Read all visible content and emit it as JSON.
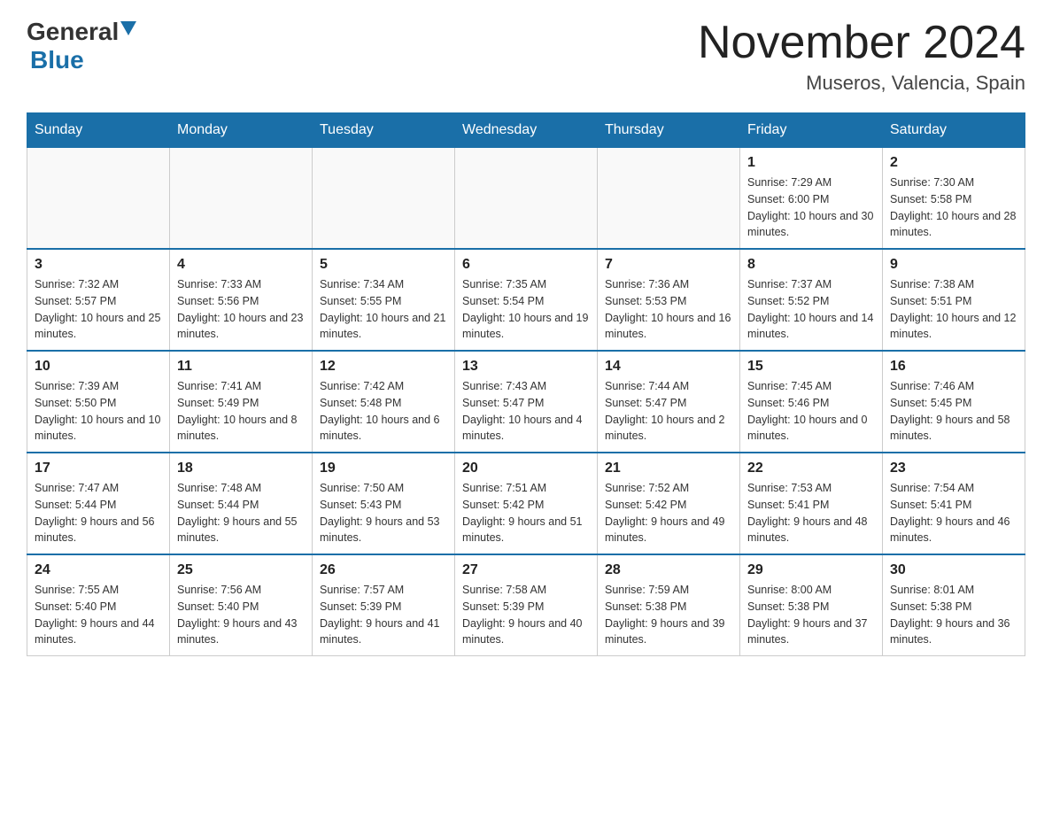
{
  "header": {
    "logo_general": "General",
    "logo_blue": "Blue",
    "month_title": "November 2024",
    "location": "Museros, Valencia, Spain"
  },
  "weekdays": [
    "Sunday",
    "Monday",
    "Tuesday",
    "Wednesday",
    "Thursday",
    "Friday",
    "Saturday"
  ],
  "weeks": [
    [
      {
        "day": "",
        "sunrise": "",
        "sunset": "",
        "daylight": ""
      },
      {
        "day": "",
        "sunrise": "",
        "sunset": "",
        "daylight": ""
      },
      {
        "day": "",
        "sunrise": "",
        "sunset": "",
        "daylight": ""
      },
      {
        "day": "",
        "sunrise": "",
        "sunset": "",
        "daylight": ""
      },
      {
        "day": "",
        "sunrise": "",
        "sunset": "",
        "daylight": ""
      },
      {
        "day": "1",
        "sunrise": "Sunrise: 7:29 AM",
        "sunset": "Sunset: 6:00 PM",
        "daylight": "Daylight: 10 hours and 30 minutes."
      },
      {
        "day": "2",
        "sunrise": "Sunrise: 7:30 AM",
        "sunset": "Sunset: 5:58 PM",
        "daylight": "Daylight: 10 hours and 28 minutes."
      }
    ],
    [
      {
        "day": "3",
        "sunrise": "Sunrise: 7:32 AM",
        "sunset": "Sunset: 5:57 PM",
        "daylight": "Daylight: 10 hours and 25 minutes."
      },
      {
        "day": "4",
        "sunrise": "Sunrise: 7:33 AM",
        "sunset": "Sunset: 5:56 PM",
        "daylight": "Daylight: 10 hours and 23 minutes."
      },
      {
        "day": "5",
        "sunrise": "Sunrise: 7:34 AM",
        "sunset": "Sunset: 5:55 PM",
        "daylight": "Daylight: 10 hours and 21 minutes."
      },
      {
        "day": "6",
        "sunrise": "Sunrise: 7:35 AM",
        "sunset": "Sunset: 5:54 PM",
        "daylight": "Daylight: 10 hours and 19 minutes."
      },
      {
        "day": "7",
        "sunrise": "Sunrise: 7:36 AM",
        "sunset": "Sunset: 5:53 PM",
        "daylight": "Daylight: 10 hours and 16 minutes."
      },
      {
        "day": "8",
        "sunrise": "Sunrise: 7:37 AM",
        "sunset": "Sunset: 5:52 PM",
        "daylight": "Daylight: 10 hours and 14 minutes."
      },
      {
        "day": "9",
        "sunrise": "Sunrise: 7:38 AM",
        "sunset": "Sunset: 5:51 PM",
        "daylight": "Daylight: 10 hours and 12 minutes."
      }
    ],
    [
      {
        "day": "10",
        "sunrise": "Sunrise: 7:39 AM",
        "sunset": "Sunset: 5:50 PM",
        "daylight": "Daylight: 10 hours and 10 minutes."
      },
      {
        "day": "11",
        "sunrise": "Sunrise: 7:41 AM",
        "sunset": "Sunset: 5:49 PM",
        "daylight": "Daylight: 10 hours and 8 minutes."
      },
      {
        "day": "12",
        "sunrise": "Sunrise: 7:42 AM",
        "sunset": "Sunset: 5:48 PM",
        "daylight": "Daylight: 10 hours and 6 minutes."
      },
      {
        "day": "13",
        "sunrise": "Sunrise: 7:43 AM",
        "sunset": "Sunset: 5:47 PM",
        "daylight": "Daylight: 10 hours and 4 minutes."
      },
      {
        "day": "14",
        "sunrise": "Sunrise: 7:44 AM",
        "sunset": "Sunset: 5:47 PM",
        "daylight": "Daylight: 10 hours and 2 minutes."
      },
      {
        "day": "15",
        "sunrise": "Sunrise: 7:45 AM",
        "sunset": "Sunset: 5:46 PM",
        "daylight": "Daylight: 10 hours and 0 minutes."
      },
      {
        "day": "16",
        "sunrise": "Sunrise: 7:46 AM",
        "sunset": "Sunset: 5:45 PM",
        "daylight": "Daylight: 9 hours and 58 minutes."
      }
    ],
    [
      {
        "day": "17",
        "sunrise": "Sunrise: 7:47 AM",
        "sunset": "Sunset: 5:44 PM",
        "daylight": "Daylight: 9 hours and 56 minutes."
      },
      {
        "day": "18",
        "sunrise": "Sunrise: 7:48 AM",
        "sunset": "Sunset: 5:44 PM",
        "daylight": "Daylight: 9 hours and 55 minutes."
      },
      {
        "day": "19",
        "sunrise": "Sunrise: 7:50 AM",
        "sunset": "Sunset: 5:43 PM",
        "daylight": "Daylight: 9 hours and 53 minutes."
      },
      {
        "day": "20",
        "sunrise": "Sunrise: 7:51 AM",
        "sunset": "Sunset: 5:42 PM",
        "daylight": "Daylight: 9 hours and 51 minutes."
      },
      {
        "day": "21",
        "sunrise": "Sunrise: 7:52 AM",
        "sunset": "Sunset: 5:42 PM",
        "daylight": "Daylight: 9 hours and 49 minutes."
      },
      {
        "day": "22",
        "sunrise": "Sunrise: 7:53 AM",
        "sunset": "Sunset: 5:41 PM",
        "daylight": "Daylight: 9 hours and 48 minutes."
      },
      {
        "day": "23",
        "sunrise": "Sunrise: 7:54 AM",
        "sunset": "Sunset: 5:41 PM",
        "daylight": "Daylight: 9 hours and 46 minutes."
      }
    ],
    [
      {
        "day": "24",
        "sunrise": "Sunrise: 7:55 AM",
        "sunset": "Sunset: 5:40 PM",
        "daylight": "Daylight: 9 hours and 44 minutes."
      },
      {
        "day": "25",
        "sunrise": "Sunrise: 7:56 AM",
        "sunset": "Sunset: 5:40 PM",
        "daylight": "Daylight: 9 hours and 43 minutes."
      },
      {
        "day": "26",
        "sunrise": "Sunrise: 7:57 AM",
        "sunset": "Sunset: 5:39 PM",
        "daylight": "Daylight: 9 hours and 41 minutes."
      },
      {
        "day": "27",
        "sunrise": "Sunrise: 7:58 AM",
        "sunset": "Sunset: 5:39 PM",
        "daylight": "Daylight: 9 hours and 40 minutes."
      },
      {
        "day": "28",
        "sunrise": "Sunrise: 7:59 AM",
        "sunset": "Sunset: 5:38 PM",
        "daylight": "Daylight: 9 hours and 39 minutes."
      },
      {
        "day": "29",
        "sunrise": "Sunrise: 8:00 AM",
        "sunset": "Sunset: 5:38 PM",
        "daylight": "Daylight: 9 hours and 37 minutes."
      },
      {
        "day": "30",
        "sunrise": "Sunrise: 8:01 AM",
        "sunset": "Sunset: 5:38 PM",
        "daylight": "Daylight: 9 hours and 36 minutes."
      }
    ]
  ]
}
